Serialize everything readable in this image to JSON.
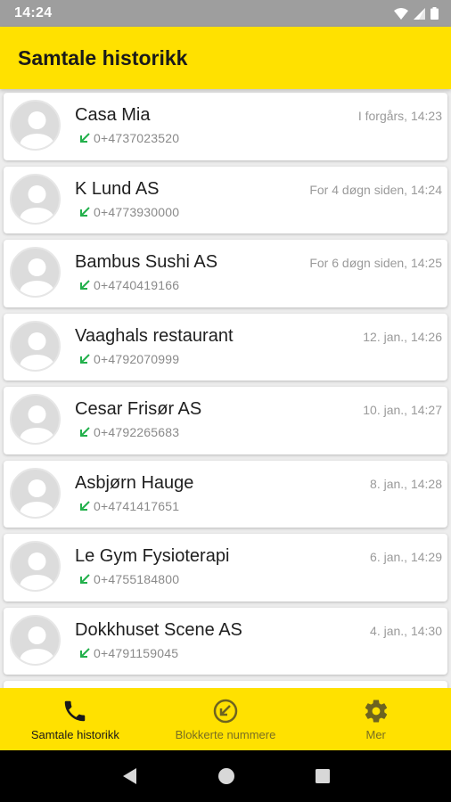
{
  "status_bar": {
    "time": "14:24"
  },
  "app_bar": {
    "title": "Samtale historikk"
  },
  "calls": [
    {
      "name": "Casa Mia",
      "number": "0+4737023520",
      "time": "I forgårs, 14:23"
    },
    {
      "name": "K Lund AS",
      "number": "0+4773930000",
      "time": "For 4 døgn siden, 14:24"
    },
    {
      "name": "Bambus Sushi AS",
      "number": "0+4740419166",
      "time": "For 6 døgn siden, 14:25"
    },
    {
      "name": "Vaaghals restaurant",
      "number": "0+4792070999",
      "time": "12. jan., 14:26"
    },
    {
      "name": "Cesar Frisør AS",
      "number": "0+4792265683",
      "time": "10. jan., 14:27"
    },
    {
      "name": "Asbjørn Hauge",
      "number": "0+4741417651",
      "time": "8. jan., 14:28"
    },
    {
      "name": "Le Gym Fysioterapi",
      "number": "0+4755184800",
      "time": "6. jan., 14:29"
    },
    {
      "name": "Dokkhuset Scene AS",
      "number": "0+4791159045",
      "time": "4. jan., 14:30"
    }
  ],
  "call_direction_icon": "incoming-call-arrow-icon",
  "bottom_nav": {
    "items": [
      {
        "label": "Samtale historikk",
        "icon": "phone-icon",
        "active": true
      },
      {
        "label": "Blokkerte nummere",
        "icon": "blocked-number-icon",
        "active": false
      },
      {
        "label": "Mer",
        "icon": "gear-icon",
        "active": false
      }
    ]
  },
  "colors": {
    "accent": "#ffe100",
    "incoming_arrow": "#22b04b",
    "status_bar": "#9e9e9e"
  }
}
